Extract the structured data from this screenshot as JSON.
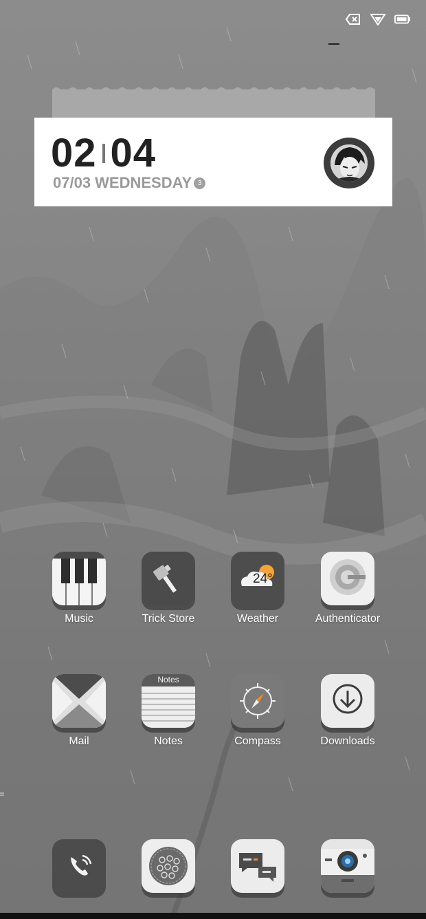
{
  "widget": {
    "hour": "02",
    "minute": "04",
    "date": "07/03 WEDNESDAY",
    "badge": "3"
  },
  "apps": [
    {
      "label": "Music",
      "icon": "piano-keys-icon"
    },
    {
      "label": "Trick Store",
      "icon": "hammer-icon"
    },
    {
      "label": "Weather",
      "icon": "cloud-sun-icon",
      "temp": "24°"
    },
    {
      "label": "Authenticator",
      "icon": "google-authenticator-icon"
    },
    {
      "label": "Mail",
      "icon": "envelope-icon"
    },
    {
      "label": "Notes",
      "icon": "notepad-icon",
      "header": "Notes"
    },
    {
      "label": "Compass",
      "icon": "compass-icon"
    },
    {
      "label": "Downloads",
      "icon": "download-arrow-icon"
    }
  ],
  "dock": [
    {
      "icon": "phone-icon"
    },
    {
      "icon": "stars-badge-icon"
    },
    {
      "icon": "chat-bubbles-icon"
    },
    {
      "icon": "camera-icon"
    }
  ],
  "status": {
    "icons": [
      "no-sim-icon",
      "wifi-icon",
      "battery-icon"
    ]
  },
  "colors": {
    "wallpaper": "#7c7c7c",
    "widget_bg": "#ffffff",
    "label": "#ffffff"
  }
}
